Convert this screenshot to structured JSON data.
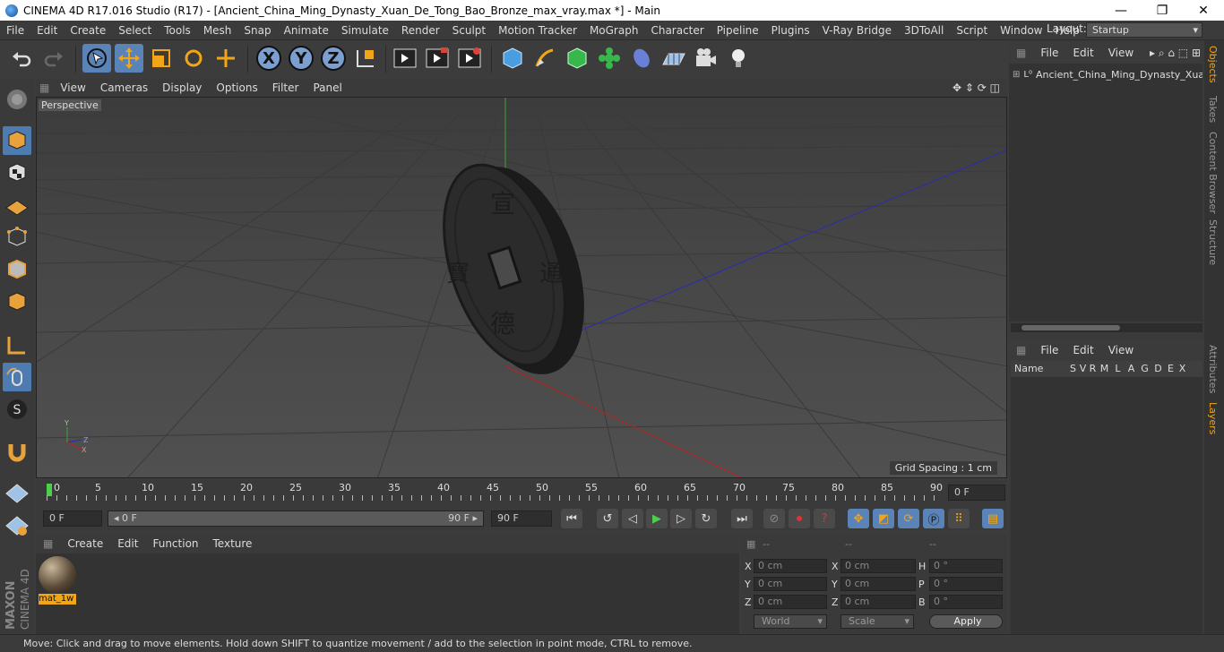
{
  "titlebar": {
    "title": "CINEMA 4D R17.016 Studio (R17) - [Ancient_China_Ming_Dynasty_Xuan_De_Tong_Bao_Bronze_max_vray.max *] - Main",
    "minimize": "—",
    "maximize": "❐",
    "close": "✕"
  },
  "menubar": [
    "File",
    "Edit",
    "Create",
    "Select",
    "Tools",
    "Mesh",
    "Snap",
    "Animate",
    "Simulate",
    "Render",
    "Sculpt",
    "Motion Tracker",
    "MoGraph",
    "Character",
    "Pipeline",
    "Plugins",
    "V-Ray Bridge",
    "3DToAll",
    "Script",
    "Window",
    "Help"
  ],
  "layout": {
    "label": "Layout:",
    "value": "Startup"
  },
  "toolbar": {
    "axis": [
      "X",
      "Y",
      "Z"
    ]
  },
  "viewport": {
    "menu": [
      "View",
      "Cameras",
      "Display",
      "Options",
      "Filter",
      "Panel"
    ],
    "label": "Perspective",
    "grid_spacing": "Grid Spacing : 1 cm",
    "axes": {
      "y": "Y",
      "z": "Z",
      "x": "X"
    }
  },
  "timeline": {
    "ticks": [
      "0",
      "5",
      "10",
      "15",
      "20",
      "25",
      "30",
      "35",
      "40",
      "45",
      "50",
      "55",
      "60",
      "65",
      "70",
      "75",
      "80",
      "85",
      "90"
    ],
    "frame_field": "0 F"
  },
  "transport": {
    "start": "0 F",
    "range_start": "◂ 0 F",
    "range_end": "90 F ▸",
    "end": "90 F"
  },
  "material_manager": {
    "menu": [
      "Create",
      "Edit",
      "Function",
      "Texture"
    ],
    "material_name": "mat_1w"
  },
  "coordinates": {
    "headers": [
      "--",
      "--",
      "--"
    ],
    "rows": [
      {
        "a": "X",
        "av": "0 cm",
        "b": "X",
        "bv": "0 cm",
        "c": "H",
        "cv": "0 °"
      },
      {
        "a": "Y",
        "av": "0 cm",
        "b": "Y",
        "bv": "0 cm",
        "c": "P",
        "cv": "0 °"
      },
      {
        "a": "Z",
        "av": "0 cm",
        "b": "Z",
        "bv": "0 cm",
        "c": "B",
        "cv": "0 °"
      }
    ],
    "mode1": "World",
    "mode2": "Scale",
    "apply": "Apply"
  },
  "object_manager": {
    "menu": [
      "File",
      "Edit",
      "View"
    ],
    "object_name": "Ancient_China_Ming_Dynasty_Xuan"
  },
  "layer_manager": {
    "menu": [
      "File",
      "Edit",
      "View"
    ],
    "name_col": "Name",
    "flags": [
      "S",
      "V",
      "R",
      "M",
      "L",
      "A",
      "G",
      "D",
      "E",
      "X"
    ]
  },
  "side_tabs": [
    "Objects",
    "Takes",
    "Content Browser",
    "Structure",
    "Attributes",
    "Layers"
  ],
  "statusbar": "Move: Click and drag to move elements. Hold down SHIFT to quantize movement / add to the selection in point mode, CTRL to remove.",
  "brand": {
    "maxon": "MAXON",
    "product": "CINEMA 4D"
  }
}
